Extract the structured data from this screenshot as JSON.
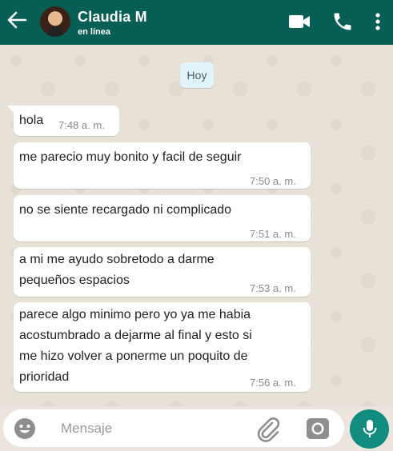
{
  "header": {
    "contact_name": "Claudia M",
    "status": "en línea",
    "icons": [
      "back-arrow-icon",
      "video-camera-icon",
      "phone-icon",
      "more-vertical-icon"
    ],
    "color": "#075e54"
  },
  "chat": {
    "date_chip": "Hoy",
    "messages": [
      {
        "lines": [
          "hola"
        ],
        "time": "7:48 a. m."
      },
      {
        "lines": [
          "me parecio muy bonito y facil de seguir"
        ],
        "time": "7:50 a. m."
      },
      {
        "lines": [
          "no se siente recargado ni complicado"
        ],
        "time": "7:51 a. m."
      },
      {
        "lines": [
          "a mi me ayudo sobretodo a darme",
          "pequeños espacios"
        ],
        "time": "7:53 a. m."
      },
      {
        "lines": [
          "parece algo minimo pero yo ya me habia",
          "acostumbrado a dejarme al final y esto si",
          "me hizo volver a ponerme un poquito de",
          "prioridad"
        ],
        "time": "7:56 a. m."
      }
    ]
  },
  "input": {
    "placeholder": "Mensaje",
    "icons": [
      "emoji-icon",
      "attach-icon",
      "camera-icon",
      "mic-icon"
    ],
    "accent": "#128c7e"
  }
}
